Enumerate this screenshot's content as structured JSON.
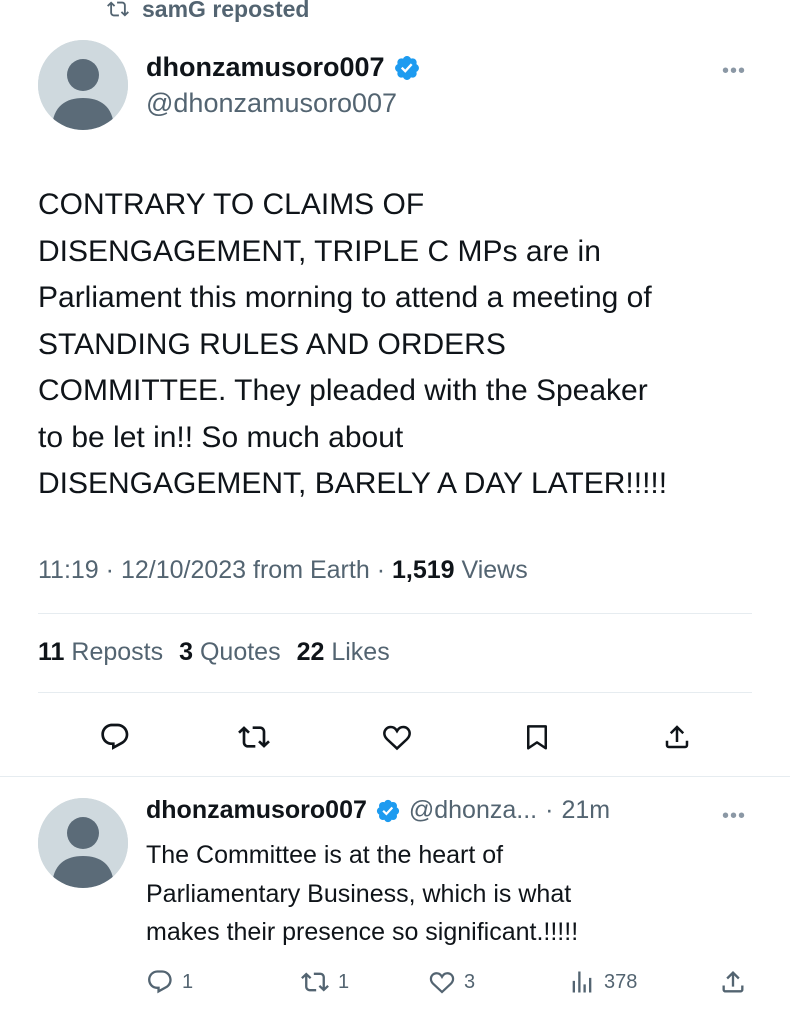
{
  "repost": {
    "label": "samG reposted"
  },
  "tweet": {
    "display_name": "dhonzamusoro007",
    "handle": "@dhonzamusoro007",
    "more": "•••",
    "text": "CONTRARY TO CLAIMS OF\nDISENGAGEMENT, TRIPLE C MPs are in\nParliament this morning to attend a meeting of\nSTANDING RULES AND ORDERS\nCOMMITTEE. They pleaded with the Speaker\nto be let in!! So much about\nDISENGAGEMENT, BARELY A DAY LATER!!!!!",
    "time": "11:19",
    "sep1": "·",
    "date": "12/10/2023",
    "source": "from Earth",
    "sep2": "·",
    "views_count": "1,519",
    "views_label": "Views",
    "reposts_count": "11",
    "reposts_label": "Reposts",
    "quotes_count": "3",
    "quotes_label": "Quotes",
    "likes_count": "22",
    "likes_label": "Likes",
    "actions": [
      "reply-icon",
      "repost-icon",
      "like-icon",
      "bookmark-icon",
      "share-icon"
    ]
  },
  "reply": {
    "display_name": "dhonzamusoro007",
    "handle": "@dhonza...",
    "sep": "·",
    "time": "21m",
    "more": "•••",
    "text": "The Committee is at the heart of\nParliamentary Business, which is what\nmakes their presence so significant.!!!!!",
    "reply_count": "1",
    "repost_count": "1",
    "like_count": "3",
    "views_count": "378"
  },
  "colors": {
    "verified": "#1d9bf0",
    "secondary_text": "#536471",
    "primary_text": "#0f1419",
    "divider": "#e6ecf0"
  }
}
